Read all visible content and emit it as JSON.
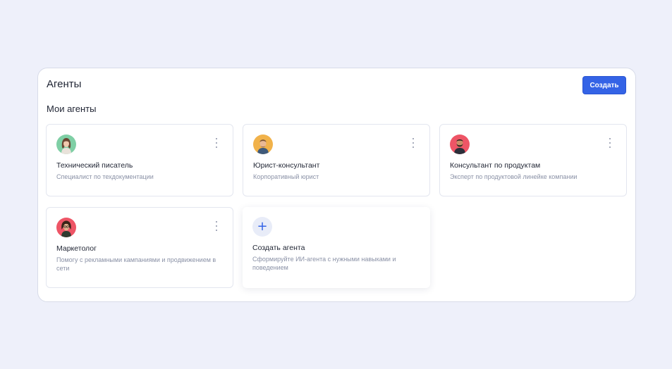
{
  "header": {
    "title": "Агенты",
    "create_label": "Создать"
  },
  "section": {
    "title": "Мои агенты"
  },
  "agents": [
    {
      "name": "Технический писатель",
      "description": "Специалист по техдокументации",
      "avatar_icon": "woman-avatar-icon",
      "avatar_bg": "#7fcfa5"
    },
    {
      "name": "Юрист-консультант",
      "description": "Корпоративный юрист",
      "avatar_icon": "man-avatar-icon",
      "avatar_bg": "#f1b24a"
    },
    {
      "name": "Консультант по продуктам",
      "description": "Эксперт по продуктовой линейке компании",
      "avatar_icon": "bearded-man-avatar-icon",
      "avatar_bg": "#ee5566"
    },
    {
      "name": "Маркетолог",
      "description": "Помогу с рекламными кампаниями и продвижением в сети",
      "avatar_icon": "woman-glasses-avatar-icon",
      "avatar_bg": "#ee5566"
    }
  ],
  "new_agent": {
    "title": "Создать агента",
    "description": "Сформируйте ИИ-агента с нужными навыками и поведением",
    "icon": "plus-icon"
  },
  "colors": {
    "page_bg": "#eef0fa",
    "accent": "#3463e6",
    "muted_text": "#8a91a6"
  }
}
